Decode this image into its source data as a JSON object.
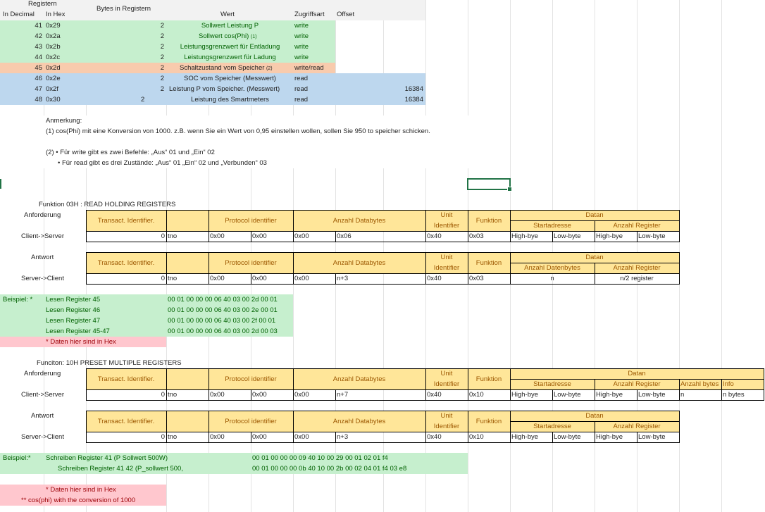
{
  "register_table": {
    "header": {
      "registern": "Registern",
      "in_decimal": "In Decimal",
      "in_hex": "In Hex",
      "bytes": "Bytes in Registern",
      "wert": "Wert",
      "zugriffsart": "Zugriffsart",
      "offset": "Offset"
    },
    "rows": [
      {
        "dec": "41",
        "hex": "0x29",
        "bytes": "2",
        "wert": "Sollwert Leistung P",
        "zugriff": "write",
        "offset": ""
      },
      {
        "dec": "42",
        "hex": "0x2a",
        "bytes": "2",
        "wert": "Sollwert cos(Phi)",
        "note": "(1)",
        "zugriff": "write",
        "offset": ""
      },
      {
        "dec": "43",
        "hex": "0x2b",
        "bytes": "2",
        "wert": "Leistungsgrenzwert für Entladung",
        "zugriff": "write",
        "offset": ""
      },
      {
        "dec": "44",
        "hex": "0x2c",
        "bytes": "2",
        "wert": "Leistungsgrenzwert für Ladung",
        "zugriff": "write",
        "offset": ""
      },
      {
        "dec": "45",
        "hex": "0x2d",
        "bytes": "2",
        "wert": "Schaltzustand vom Speicher",
        "note": "(2)",
        "zugriff": "write/read",
        "offset": ""
      },
      {
        "dec": "46",
        "hex": "0x2e",
        "bytes": "2",
        "wert": "SOC vom Speicher (Messwert)",
        "zugriff": "read",
        "offset": ""
      },
      {
        "dec": "47",
        "hex": "0x2f",
        "bytes": "2",
        "wert": "Leistung P vom Speicher. (Messwert)",
        "zugriff": "read",
        "offset": "16384"
      },
      {
        "dec": "48",
        "hex": "0x30",
        "bytes": "2",
        "wert": "Leistung des Smartmeters",
        "zugriff": "read",
        "offset": "16384"
      }
    ]
  },
  "notes": {
    "anmerkung": "Anmerkung:",
    "n1": "(1) cos(Phi) mit eine Konversion von 1000. z.B. wenn Sie ein Wert von 0,95 einstellen wollen, sollen Sie 950 to speicher schicken.",
    "n2a": "(2)  • Für write gibt es zwei Befehle: „Aus“ 01 und „Ein“ 02",
    "n2b": "• Für read gibt es drei Zustände: „Aus“ 01 „Ein“ 02 und „Verbunden“ 03"
  },
  "func03": {
    "title": "Funktion 03H : READ HOLDING REGISTERS",
    "anforderung": "Anforderung",
    "client_server": "Client->Server",
    "antwort": "Antwort",
    "server_client": "Server->Client",
    "hdr": {
      "transact": "Transact. Identifier.",
      "protocol": "Protocol identifier",
      "anzahl_databytes": "Anzahl Databytes",
      "unit1": "Unit",
      "unit2": "Identifier",
      "funktion": "Funktion",
      "datan": "Datan",
      "startadresse": "Startadresse",
      "anzahl_register": "Anzahl Register",
      "anzahl_datenbytes": "Anzahl Datenbytes"
    },
    "req": {
      "t0": "0",
      "tno": "tno",
      "p1": "0x00",
      "p2": "0x00",
      "a1": "0x00",
      "a2": "0x06",
      "unit": "0x40",
      "func": "0x03",
      "d1": "High-bye",
      "d2": "Low-byte",
      "d3": "High-bye",
      "d4": "Low-byte"
    },
    "resp": {
      "t0": "0",
      "tno": "tno",
      "p1": "0x00",
      "p2": "0x00",
      "a1": "0x00",
      "a2": "n+3",
      "unit": "0x40",
      "func": "0x03",
      "d1": "n",
      "d2": "n/2 register"
    }
  },
  "beispiel1": {
    "label": "Beispiel: *",
    "rows": [
      {
        "name": "Lesen Register 45",
        "hex": "00 01 00 00 00 06 40 03 00 2d 00 01"
      },
      {
        "name": "Lesen Register 46",
        "hex": "00 01 00 00 00 06 40 03 00 2e 00 01"
      },
      {
        "name": "Lesen Register 47",
        "hex": "00 01 00 00 00 06 40 03 00 2f 00 01"
      },
      {
        "name": "Lesen Register 45-47",
        "hex": "00 01 00 00 00 06 40 03 00 2d 00 03"
      }
    ],
    "hinweis": "* Daten hier sind in Hex"
  },
  "func10": {
    "title": "Funciton: 10H PRESET MULTIPLE REGISTERS",
    "anforderung": "Anforderung",
    "client_server": "Client->Server",
    "antwort": "Antwort",
    "server_client": "Server->Client",
    "hdr": {
      "transact": "Transact. Identifier.",
      "protocol": "Protocol identifier",
      "anzahl_databytes": "Anzahl Databytes",
      "unit1": "Unit",
      "unit2": "Identifier",
      "funktion": "Funktion",
      "datan": "Datan",
      "startadresse": "Startadresse",
      "anzahl_register": "Anzahl Register",
      "anzahl_bytes": "Anzahl bytes",
      "info": "Info"
    },
    "req": {
      "t0": "0",
      "tno": "tno",
      "p1": "0x00",
      "p2": "0x00",
      "a1": "0x00",
      "a2": "n+7",
      "unit": "0x40",
      "func": "0x10",
      "d1": "High-bye",
      "d2": "Low-byte",
      "d3": "High-bye",
      "d4": "Low-byte",
      "n": "n",
      "nbytes": "n bytes"
    },
    "resp": {
      "t0": "0",
      "tno": "tno",
      "p1": "0x00",
      "p2": "0x00",
      "a1": "0x00",
      "a2": "n+3",
      "unit": "0x40",
      "func": "0x10",
      "d1": "High-bye",
      "d2": "Low-byte",
      "d3": "High-bye",
      "d4": "Low-byte"
    }
  },
  "beispiel2": {
    "label": "Beispiel:*",
    "r1name": "Schreiben Register 41 (P Sollwert 500W)",
    "r1hex": "00 01 00 00 00 09 40 10 00 29 00 01 02 01 f4",
    "r2name": "Schreiben Register 41 42 (P_sollwert 500,",
    "r2hex": "00 01 00 00 00 0b 40 10 00 2b 00 02  04 01 f4 03 e8",
    "hinweis1": "* Daten hier sind in Hex",
    "hinweis2": "** cos(phi) with the conversion of 1000"
  },
  "colors": {
    "yellow": "#ffe699",
    "green": "#c6efce",
    "orange": "#f8cbad",
    "blue": "#bdd7ee",
    "pink": "#ffc7ce",
    "selection": "#217346"
  }
}
